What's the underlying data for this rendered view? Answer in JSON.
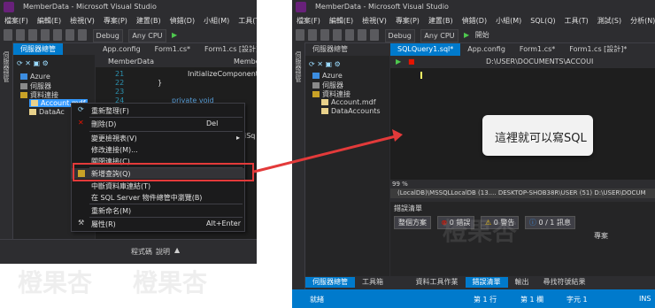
{
  "left": {
    "window_title": "MemberData - Microsoft Visual Studio",
    "menu": [
      "檔案(F)",
      "編輯(E)",
      "檢視(V)",
      "專案(P)",
      "建置(B)",
      "偵錯(D)",
      "小組(M)",
      "工具(T)"
    ],
    "toolbar": {
      "config": "Debug",
      "platform": "Any CPU"
    },
    "sidebar_label": "伺服器總管",
    "panel_tab": "伺服器總管",
    "doc_tabs": [
      "App.config",
      "Form1.cs*",
      "Form1.cs [設計]"
    ],
    "breadcrumb": "MemberData",
    "breadcrumb2": "Member",
    "tree": [
      "Azure",
      "伺服器",
      "資料連接",
      "Account.mdf",
      "DataAc"
    ],
    "code_lines": [
      "21",
      "22",
      "23",
      "24",
      "25"
    ],
    "code_text": [
      "InitializeComponent(",
      "}",
      "",
      "private void btnCheck_Cl",
      "{"
    ],
    "code_side": [
      "iSq"
    ],
    "context_menu": [
      {
        "label": "重新整理(F)",
        "key": ""
      },
      {
        "label": "刪除(D)",
        "key": "Del"
      },
      {
        "label": "變更檢視表(V)",
        "key": ""
      },
      {
        "label": "修改連接(M)...",
        "key": ""
      },
      {
        "label": "關閉連接(C)",
        "key": ""
      },
      {
        "label": "新增查詢(Q)",
        "key": ""
      },
      {
        "label": "中斷資料庫連結(T)",
        "key": ""
      },
      {
        "label": "在 SQL Server 物件總管中瀏覽(B)",
        "key": ""
      },
      {
        "label": "重新命名(M)",
        "key": ""
      },
      {
        "label": "屬性(R)",
        "key": "Alt+Enter"
      }
    ],
    "footer_tabs": [
      "程式碼",
      "說明"
    ]
  },
  "right": {
    "window_title": "MemberData - Microsoft Visual Studio",
    "menu": [
      "檔案(F)",
      "編輯(E)",
      "檢視(V)",
      "專案(P)",
      "建置(B)",
      "偵錯(D)",
      "小組(M)",
      "SQL(Q)",
      "工具(T)",
      "測試(S)",
      "分析(N)"
    ],
    "toolbar": {
      "config": "Debug",
      "platform": "Any CPU",
      "start": "開始"
    },
    "panel_tab": "伺服器總管",
    "doc_tabs": [
      "SQLQuery1.sql*",
      "App.config",
      "Form1.cs*",
      "Form1.cs [設計]*"
    ],
    "path": "D:\\USER\\DOCUMENTS\\ACCOUI",
    "tree": [
      "Azure",
      "伺服器",
      "資料連接",
      "Account.mdf",
      "DataAccounts"
    ],
    "zoom": "99 %",
    "conn": "(LocalDB)\\MSSQLLocalDB (13....   DESKTOP-SHOB38R\\USER (51)   D:\\USER\\DOCUM",
    "errlist_title": "錯誤清單",
    "scope": "整個方案",
    "errors": "0 錯誤",
    "warnings": "0 警告",
    "messages": "0 / 1 訊息",
    "col_project": "專案",
    "bottom_tabs": [
      "伺服器總管",
      "工具箱",
      "資料工具作業",
      "錯誤清單",
      "輸出",
      "尋找符號結果"
    ],
    "status": {
      "ready": "就緒",
      "line": "第 1 行",
      "col": "第 1 欄",
      "char": "字元 1",
      "ins": "INS"
    }
  },
  "annotation": "這裡就可以寫SQL",
  "watermark": "橙果杏",
  "colors": {
    "accent": "#007acc",
    "highlight": "#e33a3a",
    "bg": "#2d2d30"
  }
}
